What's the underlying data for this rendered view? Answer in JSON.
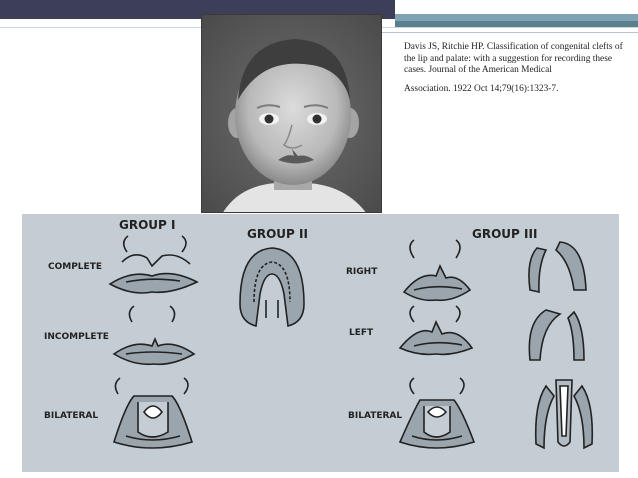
{
  "citation": {
    "line1": "Davis JS, Ritchie HP. Classification of congenital clefts of the lip and palate: with a suggestion for recording these cases. Journal of the American Medical",
    "line2": "Association. 1922 Oct 14;79(16):1323-7."
  },
  "diagram": {
    "group1": "GROUP I",
    "group2": "GROUP II",
    "group3": "GROUP III",
    "complete": "COMPLETE",
    "incomplete": "INCOMPLETE",
    "bilateral_left": "BILATERAL",
    "right": "RIGHT",
    "left": "LEFT",
    "bilateral_right": "BILATERAL"
  }
}
